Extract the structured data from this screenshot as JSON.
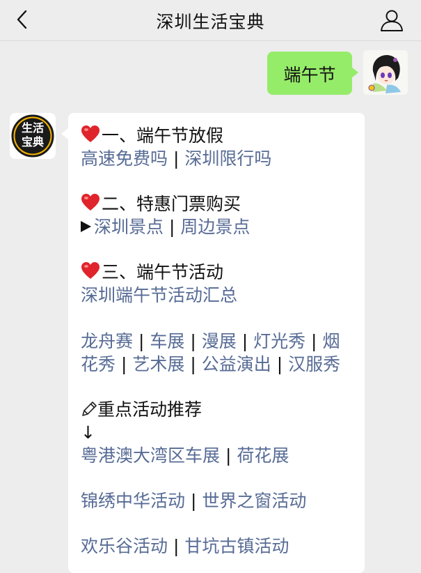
{
  "header": {
    "title": "深圳生活宝典"
  },
  "outgoing": {
    "text": "端午节"
  },
  "bot_avatar": {
    "lines": [
      "生活",
      "宝典"
    ]
  },
  "sections": {
    "s1": {
      "heading": "一、端午节放假",
      "links": [
        "高速免费吗",
        "深圳限行吗"
      ]
    },
    "s2": {
      "heading": "二、特惠门票购买",
      "links": [
        "深圳景点",
        "周边景点"
      ]
    },
    "s3": {
      "heading": "三、端午节活动",
      "link": "深圳端午节活动汇总"
    },
    "activities": {
      "row1": [
        "龙舟赛",
        "车展",
        "漫展",
        "灯光秀",
        "烟"
      ],
      "row2": [
        "花秀",
        "艺术展",
        "公益演出",
        "汉服秀"
      ]
    },
    "s4": {
      "heading": "重点活动推荐",
      "arrow": "↓"
    },
    "recs": {
      "r1": [
        "粤港澳大湾区车展",
        "荷花展"
      ],
      "r2": [
        "锦绣中华活动",
        "世界之窗活动"
      ],
      "r3": [
        "欢乐谷活动",
        "甘坑古镇活动"
      ]
    }
  },
  "separator": "|",
  "colors": {
    "link": "#576b95",
    "outgoing_bubble": "#95ec69",
    "heart": "#e0242c",
    "background": "#ededed"
  },
  "icons": [
    "back-icon",
    "user-icon",
    "heart-icon",
    "play-icon",
    "pencil-icon",
    "anime-avatar"
  ]
}
